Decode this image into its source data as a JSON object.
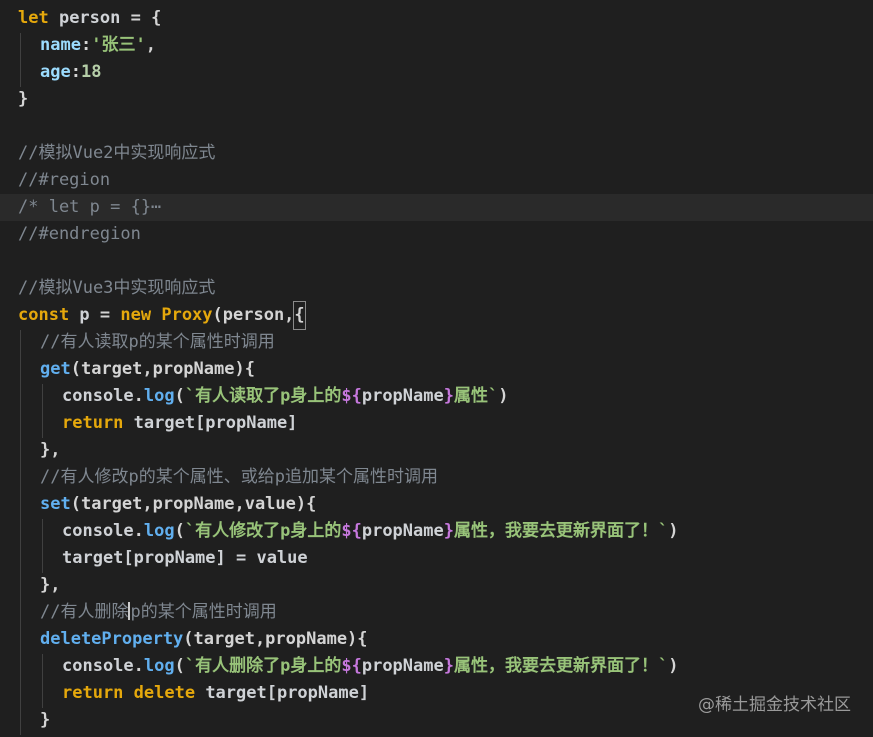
{
  "code": {
    "l1": {
      "kw": "let",
      "name": " person ",
      "op": "= {"
    },
    "l2": {
      "key": "name",
      "colon": ":",
      "val": "'张三'",
      "comma": ","
    },
    "l3": {
      "key": "age",
      "colon": ":",
      "val": "18"
    },
    "l4": {
      "text": "}"
    },
    "l6": {
      "comment": "//模拟Vue2中实现响应式"
    },
    "l7": {
      "comment": "//#region"
    },
    "l8": {
      "comment": "/* let p = {}⋯"
    },
    "l9": {
      "comment": "//#endregion"
    },
    "l11": {
      "comment": "//模拟Vue3中实现响应式"
    },
    "l12": {
      "kw": "const",
      "name": " p ",
      "op": "= ",
      "new": "new",
      "cls": " Proxy",
      "args": "(person,",
      "brace": "{"
    },
    "l13": {
      "comment": "//有人读取p的某个属性时调用"
    },
    "l14": {
      "fn": "get",
      "args": "(target,propName){"
    },
    "l15": {
      "obj": "console",
      "dot": ".",
      "fn": "log",
      "open": "(",
      "str1": "`有人读取了p身上的",
      "tpl_open": "${",
      "tpl_var": "propName",
      "tpl_close": "}",
      "str2": "属性`",
      "close": ")"
    },
    "l16": {
      "kw": "return",
      "rest": " target[propName]"
    },
    "l17": {
      "text": "},"
    },
    "l18": {
      "comment": "//有人修改p的某个属性、或给p追加某个属性时调用"
    },
    "l19": {
      "fn": "set",
      "args": "(target,propName,value){"
    },
    "l20": {
      "obj": "console",
      "dot": ".",
      "fn": "log",
      "open": "(",
      "str1": "`有人修改了p身上的",
      "tpl_open": "${",
      "tpl_var": "propName",
      "tpl_close": "}",
      "str2": "属性，我要去更新界面了！`",
      "close": ")"
    },
    "l21": {
      "text": "target[propName] = value"
    },
    "l22": {
      "text": "},"
    },
    "l23": {
      "comment_a": "//有人删除",
      "comment_b": "p的某个属性时调用"
    },
    "l24": {
      "fn": "deleteProperty",
      "args": "(target,propName){"
    },
    "l25": {
      "obj": "console",
      "dot": ".",
      "fn": "log",
      "open": "(",
      "str1": "`有人删除了p身上的",
      "tpl_open": "${",
      "tpl_var": "propName",
      "tpl_close": "}",
      "str2": "属性，我要去更新界面了！`",
      "close": ")"
    },
    "l26": {
      "kw": "return",
      "kw2": " delete",
      "rest": " target[propName]"
    },
    "l27": {
      "text": "}"
    }
  },
  "watermark": "@稀土掘金技术社区",
  "colors": {
    "background": "#1f1f1f",
    "keyword": "#e5a80c",
    "function": "#61afef",
    "string": "#98c379",
    "comment": "#7f8790",
    "template_var": "#c678dd"
  }
}
